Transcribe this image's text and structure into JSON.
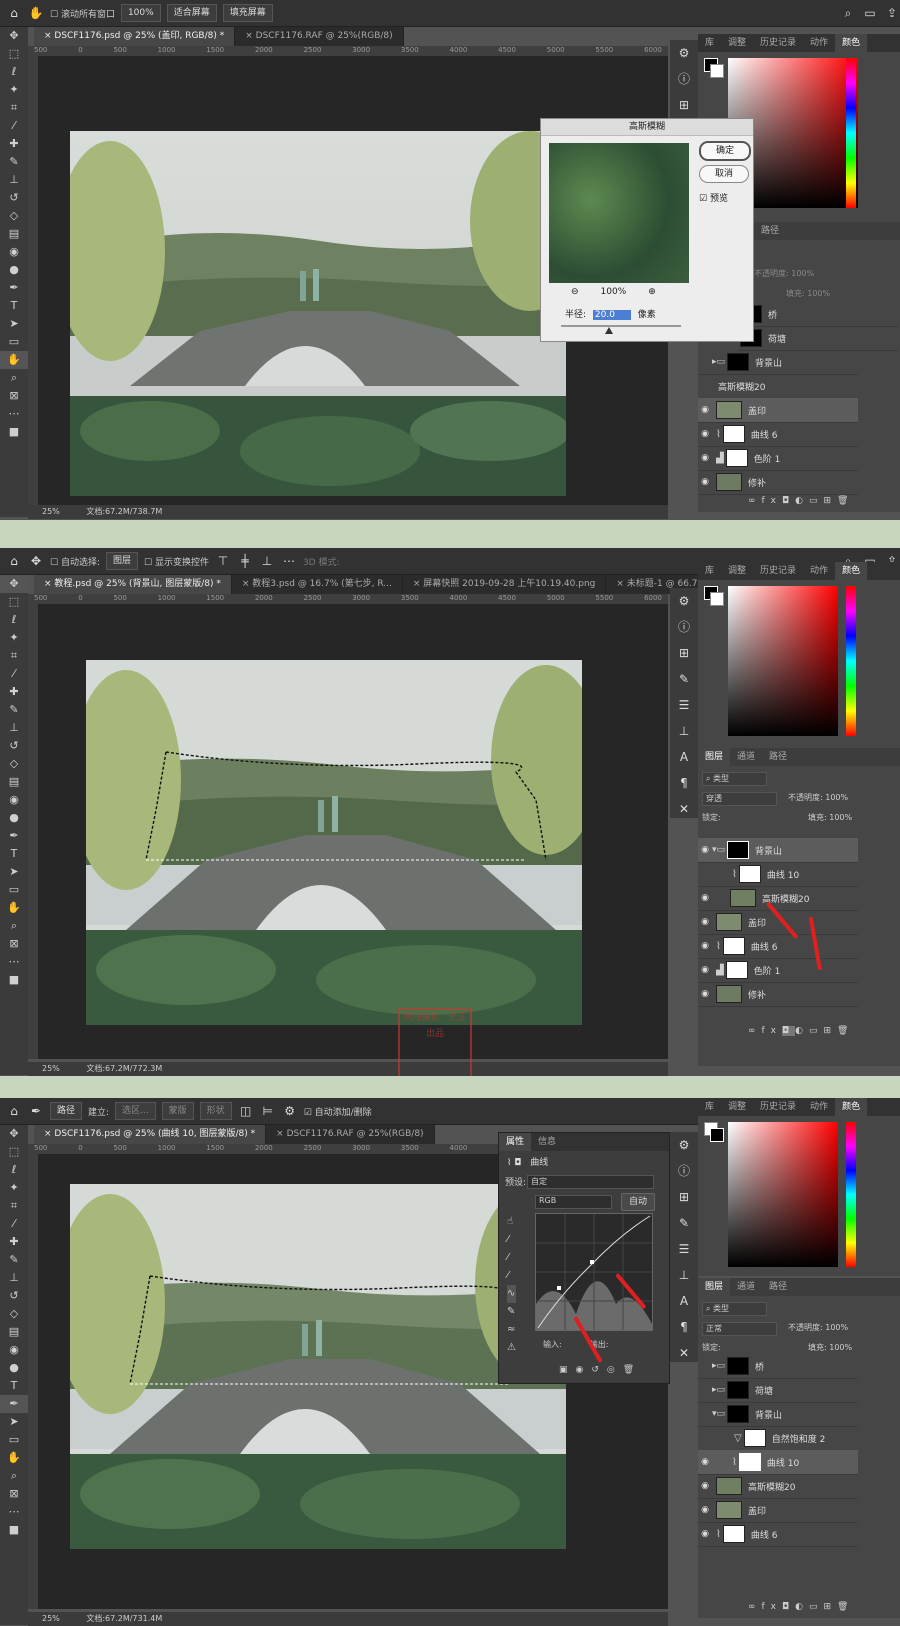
{
  "p1": {
    "opt_scroll": "滚动所有窗口",
    "opt_zoom": "100%",
    "opt_fit": "适合屏幕",
    "opt_fill": "填充屏幕",
    "tabs": [
      "DSCF1176.psd @ 25% (盖印, RGB/8) *",
      "DSCF1176.RAF @ 25%(RGB/8)"
    ],
    "ruler": [
      "500",
      "0",
      "500",
      "1000",
      "1500",
      "2000",
      "2500",
      "3000",
      "3500",
      "4000",
      "4500",
      "5000",
      "5500",
      "6000"
    ],
    "status_zoom": "25%",
    "status_doc": "文档:67.2M/738.7M",
    "panel_tabs": [
      "库",
      "调整",
      "历史记录",
      "动作",
      "颜色"
    ],
    "dialog": {
      "title": "高斯模糊",
      "ok": "确定",
      "cancel": "取消",
      "preview": "预览",
      "zoom": "100%",
      "radius_label": "半径:",
      "radius_value": "20.0",
      "unit": "像素"
    },
    "paths_tab": "路径",
    "opacity_label": "不透明度:",
    "opacity_value": "100%",
    "fill_label": "填充:",
    "fill_value": "100%",
    "layers": [
      "桥",
      "荷塘",
      "背景山",
      "高斯模糊20",
      "盖印",
      "曲线 6",
      "色阶 1",
      "修补"
    ]
  },
  "p2": {
    "opt_autoselect": "自动选择:",
    "opt_layer": "图层",
    "opt_transform": "显示变换控件",
    "opt_3d": "3D 模式:",
    "tabs": [
      "教程.psd @ 25% (背景山, 图层蒙版/8) *",
      "教程3.psd @ 16.7% (第七步, R...",
      "屏幕快照 2019-09-28 上午10.19.40.png",
      "未标题-1 @ 66.7% (图层 1"
    ],
    "ruler": [
      "500",
      "0",
      "500",
      "1000",
      "1500",
      "2000",
      "2500",
      "3000",
      "3500",
      "4000",
      "4500",
      "5000",
      "5500",
      "6000"
    ],
    "status_zoom": "25%",
    "status_doc": "文档:67.2M/772.3M",
    "panel_tabs": [
      "库",
      "调整",
      "历史记录",
      "动作",
      "颜色"
    ],
    "layer_tabs": [
      "图层",
      "通道",
      "路径"
    ],
    "kind": "类型",
    "blend": "穿透",
    "opacity_label": "不透明度:",
    "opacity_value": "100%",
    "lock_label": "锁定:",
    "fill_label": "填充:",
    "fill_value": "100%",
    "layers": [
      "背景山",
      "曲线 10",
      "高斯模糊20",
      "盖印",
      "曲线 6",
      "色阶 1",
      "修补"
    ],
    "watermark": "明阳摄影 · 允正出品"
  },
  "p3": {
    "opt_path": "路径",
    "opt_build": "建立:",
    "opt_selection": "选区...",
    "opt_mask": "蒙版",
    "opt_shape": "形状",
    "opt_auto": "自动添加/删除",
    "tabs": [
      "DSCF1176.psd @ 25% (曲线 10, 图层蒙版/8) *",
      "DSCF1176.RAF @ 25%(RGB/8)"
    ],
    "ruler": [
      "500",
      "0",
      "500",
      "1000",
      "1500",
      "2000",
      "2500",
      "3000",
      "3500",
      "4000",
      "4500",
      "5000",
      "5500",
      "6000"
    ],
    "status_zoom": "25%",
    "status_doc": "文档:67.2M/731.4M",
    "props_tabs": [
      "属性",
      "信息"
    ],
    "props_title": "曲线",
    "preset_label": "预设:",
    "preset_value": "自定",
    "channel": "RGB",
    "auto": "自动",
    "input_label": "输入:",
    "output_label": "输出:",
    "panel_tabs": [
      "库",
      "调整",
      "历史记录",
      "动作",
      "颜色"
    ],
    "layer_tabs": [
      "图层",
      "通道",
      "路径"
    ],
    "kind": "类型",
    "blend": "正常",
    "opacity_label": "不透明度:",
    "opacity_value": "100%",
    "lock_label": "锁定:",
    "fill_label": "填充:",
    "fill_value": "100%",
    "layers": [
      "桥",
      "荷塘",
      "背景山",
      "自然饱和度 2",
      "曲线 10",
      "高斯模糊20",
      "盖印",
      "曲线 6"
    ]
  }
}
